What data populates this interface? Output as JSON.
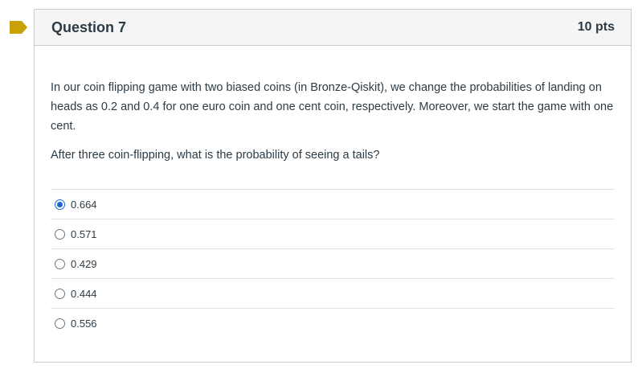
{
  "question": {
    "title": "Question 7",
    "points": "10 pts",
    "paragraphs": [
      "In our coin flipping game with two biased coins (in Bronze-Qiskit), we change the probabilities of landing on heads as 0.2 and 0.4 for one euro coin and one cent coin, respectively. Moreover, we start the game with one cent.",
      "After three coin-flipping, what is the probability of seeing a tails?"
    ],
    "answers": [
      {
        "label": "0.664",
        "selected": true
      },
      {
        "label": "0.571",
        "selected": false
      },
      {
        "label": "0.429",
        "selected": false
      },
      {
        "label": "0.444",
        "selected": false
      },
      {
        "label": "0.556",
        "selected": false
      }
    ]
  },
  "colors": {
    "flag": "#c8a008",
    "selected_radio": "#1a66d6"
  },
  "icons": {
    "flag": "question-flag-icon"
  }
}
